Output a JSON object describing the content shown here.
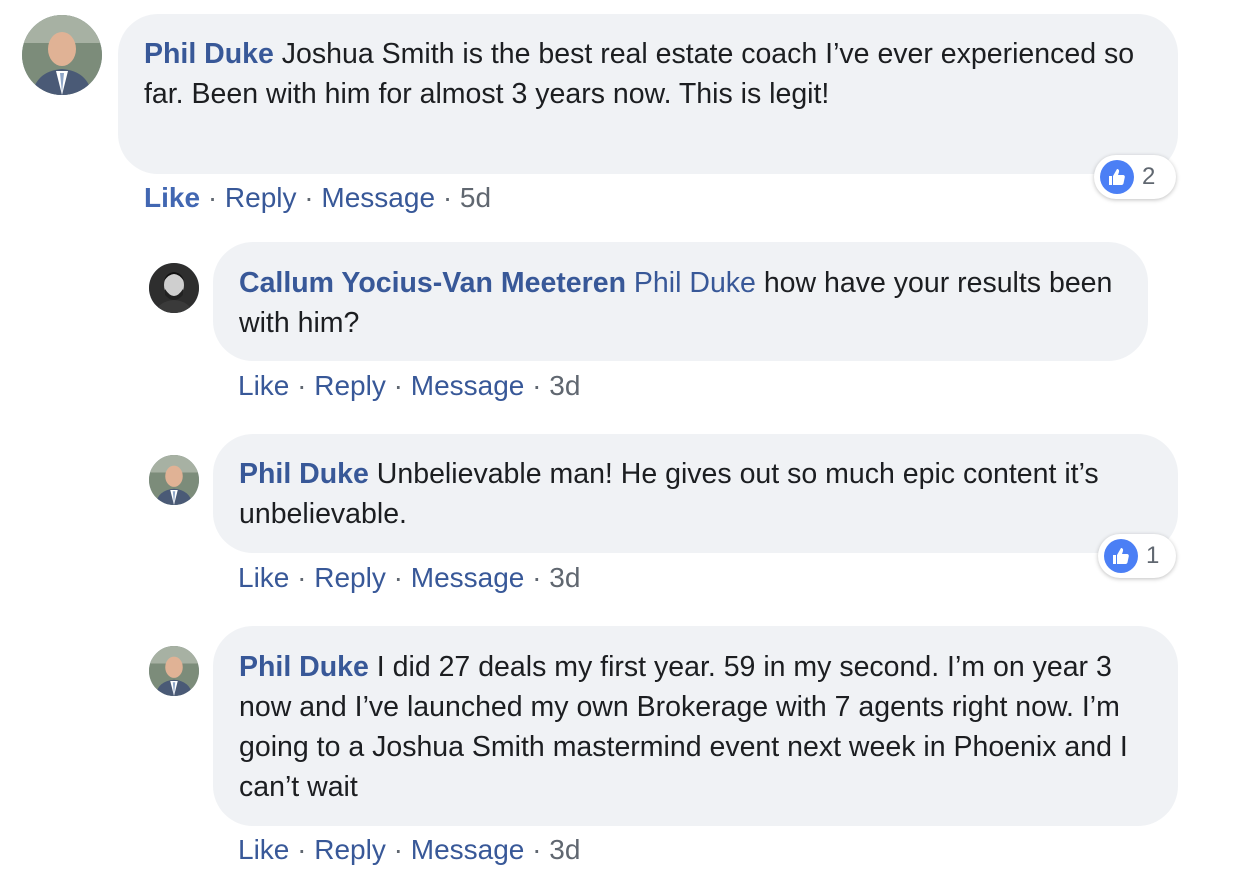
{
  "comments": [
    {
      "author": "Phil Duke",
      "text": "Joshua Smith is the best real estate coach I’ve ever experienced so far. Been with him for almost 3 years now. This is legit!",
      "reaction_count": "2",
      "time": "5d"
    },
    {
      "author": "Callum Yocius-Van Meeteren",
      "mention": "Phil Duke",
      "text": "how have your results been with him?",
      "time": "3d"
    },
    {
      "author": "Phil Duke",
      "text": "Unbelievable man! He gives out so much epic content it’s unbelievable.",
      "reaction_count": "1",
      "time": "3d"
    },
    {
      "author": "Phil Duke",
      "text": "I did 27 deals my first year. 59 in my second. I’m on year 3 now and I’ve launched my own Brokerage with 7 agents right now. I’m going to a Joshua Smith mastermind event next week in Phoenix and I can’t wait",
      "time": "3d"
    }
  ],
  "actions": {
    "like": "Like",
    "reply": "Reply",
    "message": "Message",
    "sep": "·"
  },
  "colors": {
    "bubble": "#f0f2f5",
    "link": "#385898",
    "like_active": "#4267b2",
    "reaction_icon": "#4b7ff5",
    "meta": "#606770"
  },
  "icons": {
    "reaction": "thumbs-up-icon"
  }
}
